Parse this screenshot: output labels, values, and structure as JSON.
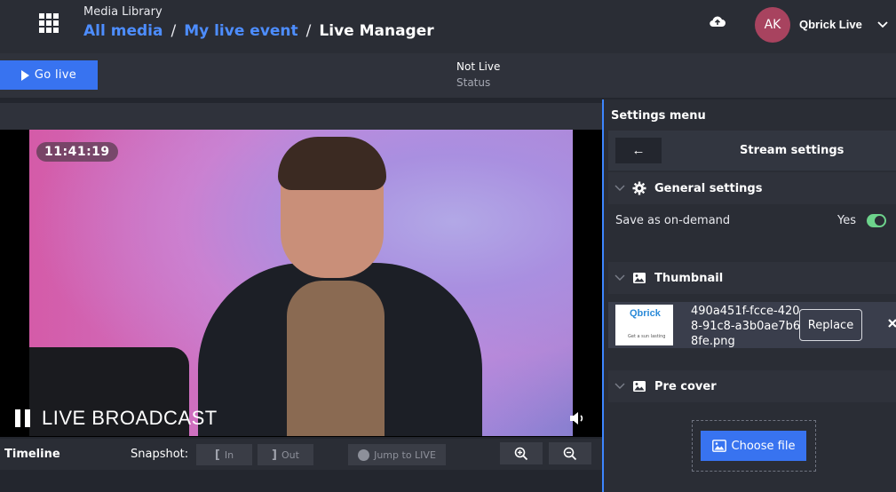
{
  "header": {
    "section_label": "Media Library",
    "breadcrumb": [
      {
        "label": "All media"
      },
      {
        "label": "My live event"
      },
      {
        "label": "Live Manager"
      }
    ],
    "separator": "/",
    "user": {
      "initials": "AK",
      "name": "Qbrick Live"
    }
  },
  "toolbar": {
    "go_live_label": "Go live",
    "status_value": "Not Live",
    "status_label": "Status"
  },
  "player": {
    "timecode": "11:41:19",
    "live_label": "LIVE BROADCAST"
  },
  "timeline": {
    "label": "Timeline",
    "snapshot_label": "Snapshot:",
    "in_label": "In",
    "out_label": "Out",
    "jump_label": "Jump to LIVE"
  },
  "settings": {
    "menu_title": "Settings menu",
    "stream_title": "Stream settings",
    "back_glyph": "←",
    "general": {
      "title": "General settings",
      "save_on_demand_label": "Save as on-demand",
      "save_on_demand_value": "Yes"
    },
    "thumbnail": {
      "title": "Thumbnail",
      "logo_text": "Qbrick",
      "tiny_text": "Get a sun lasting",
      "filename": "490a451f-fcce-4208-91c8-a3b0ae7b68fe.png",
      "replace_label": "Replace"
    },
    "precover": {
      "title": "Pre cover",
      "choose_label": "Choose file"
    }
  },
  "colors": {
    "accent": "#3873f0",
    "link": "#4d8dff",
    "toggle_on": "#6dd38c",
    "avatar": "#a8435f"
  }
}
